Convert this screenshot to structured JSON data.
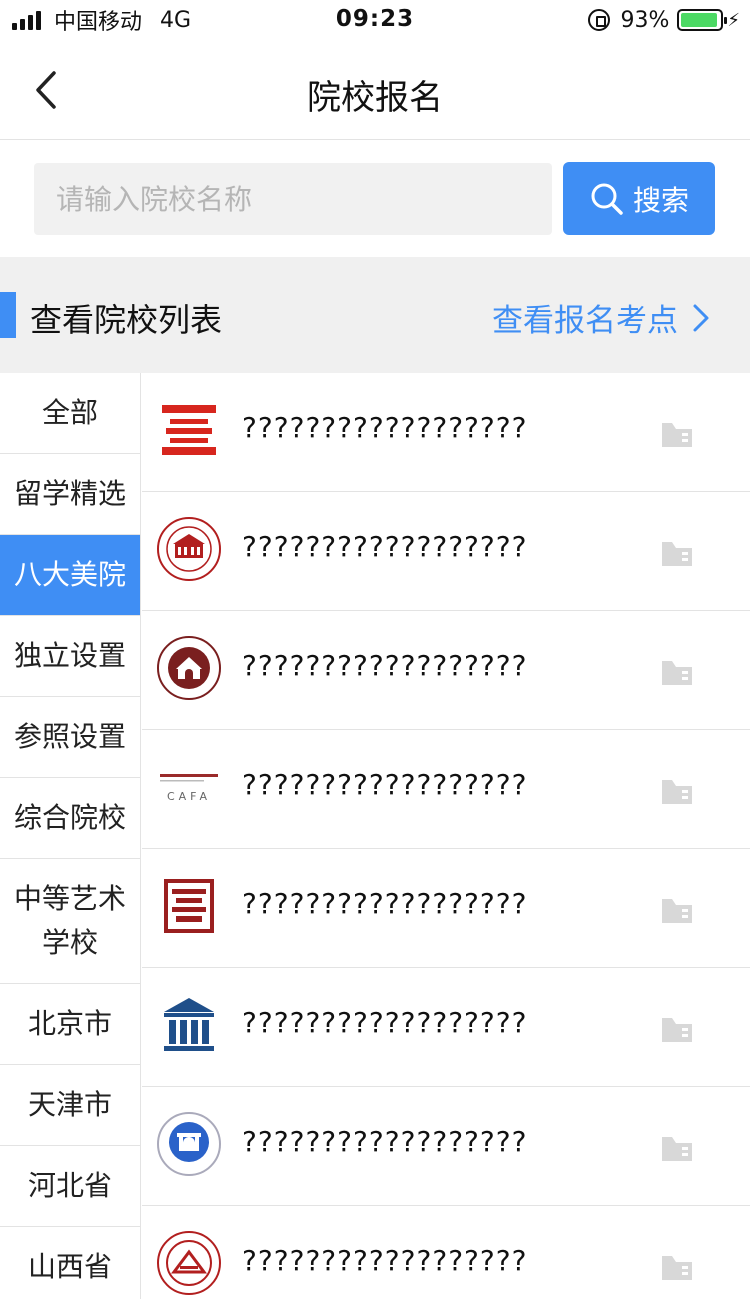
{
  "status_bar": {
    "carrier": "中国移动",
    "network": "4G",
    "time": "09:23",
    "battery_pct": "93%",
    "battery_level": 0.93
  },
  "nav": {
    "title": "院校报名"
  },
  "search": {
    "placeholder": "请输入院校名称",
    "button_label": "搜索"
  },
  "section": {
    "title": "查看院校列表",
    "link_label": "查看报名考点"
  },
  "sidebar": {
    "items": [
      {
        "label": "全部"
      },
      {
        "label": "留学精选"
      },
      {
        "label": "八大美院"
      },
      {
        "label": "独立设置"
      },
      {
        "label": "参照设置"
      },
      {
        "label": "综合院校"
      },
      {
        "label": "中等艺术学校"
      },
      {
        "label": "北京市"
      },
      {
        "label": "天津市"
      },
      {
        "label": "河北省"
      },
      {
        "label": "山西省"
      }
    ],
    "active_index": 2
  },
  "schools": [
    {
      "name": "??????????????????",
      "logo": "red-stripes-logo"
    },
    {
      "name": "??????????????????",
      "logo": "red-building-seal-logo"
    },
    {
      "name": "??????????????????",
      "logo": "maroon-arch-seal-logo"
    },
    {
      "name": "??????????????????",
      "logo": "cafa-logo",
      "logo_text": "CAFA"
    },
    {
      "name": "??????????????????",
      "logo": "red-glyph-logo"
    },
    {
      "name": "??????????????????",
      "logo": "blue-columns-logo"
    },
    {
      "name": "??????????????????",
      "logo": "blue-gate-seal-logo"
    },
    {
      "name": "??????????????????",
      "logo": "red-round-seal-logo"
    }
  ],
  "colors": {
    "accent": "#3f8ef4",
    "active_bg": "#3f8ef4",
    "section_bg": "#f0f0f0"
  }
}
